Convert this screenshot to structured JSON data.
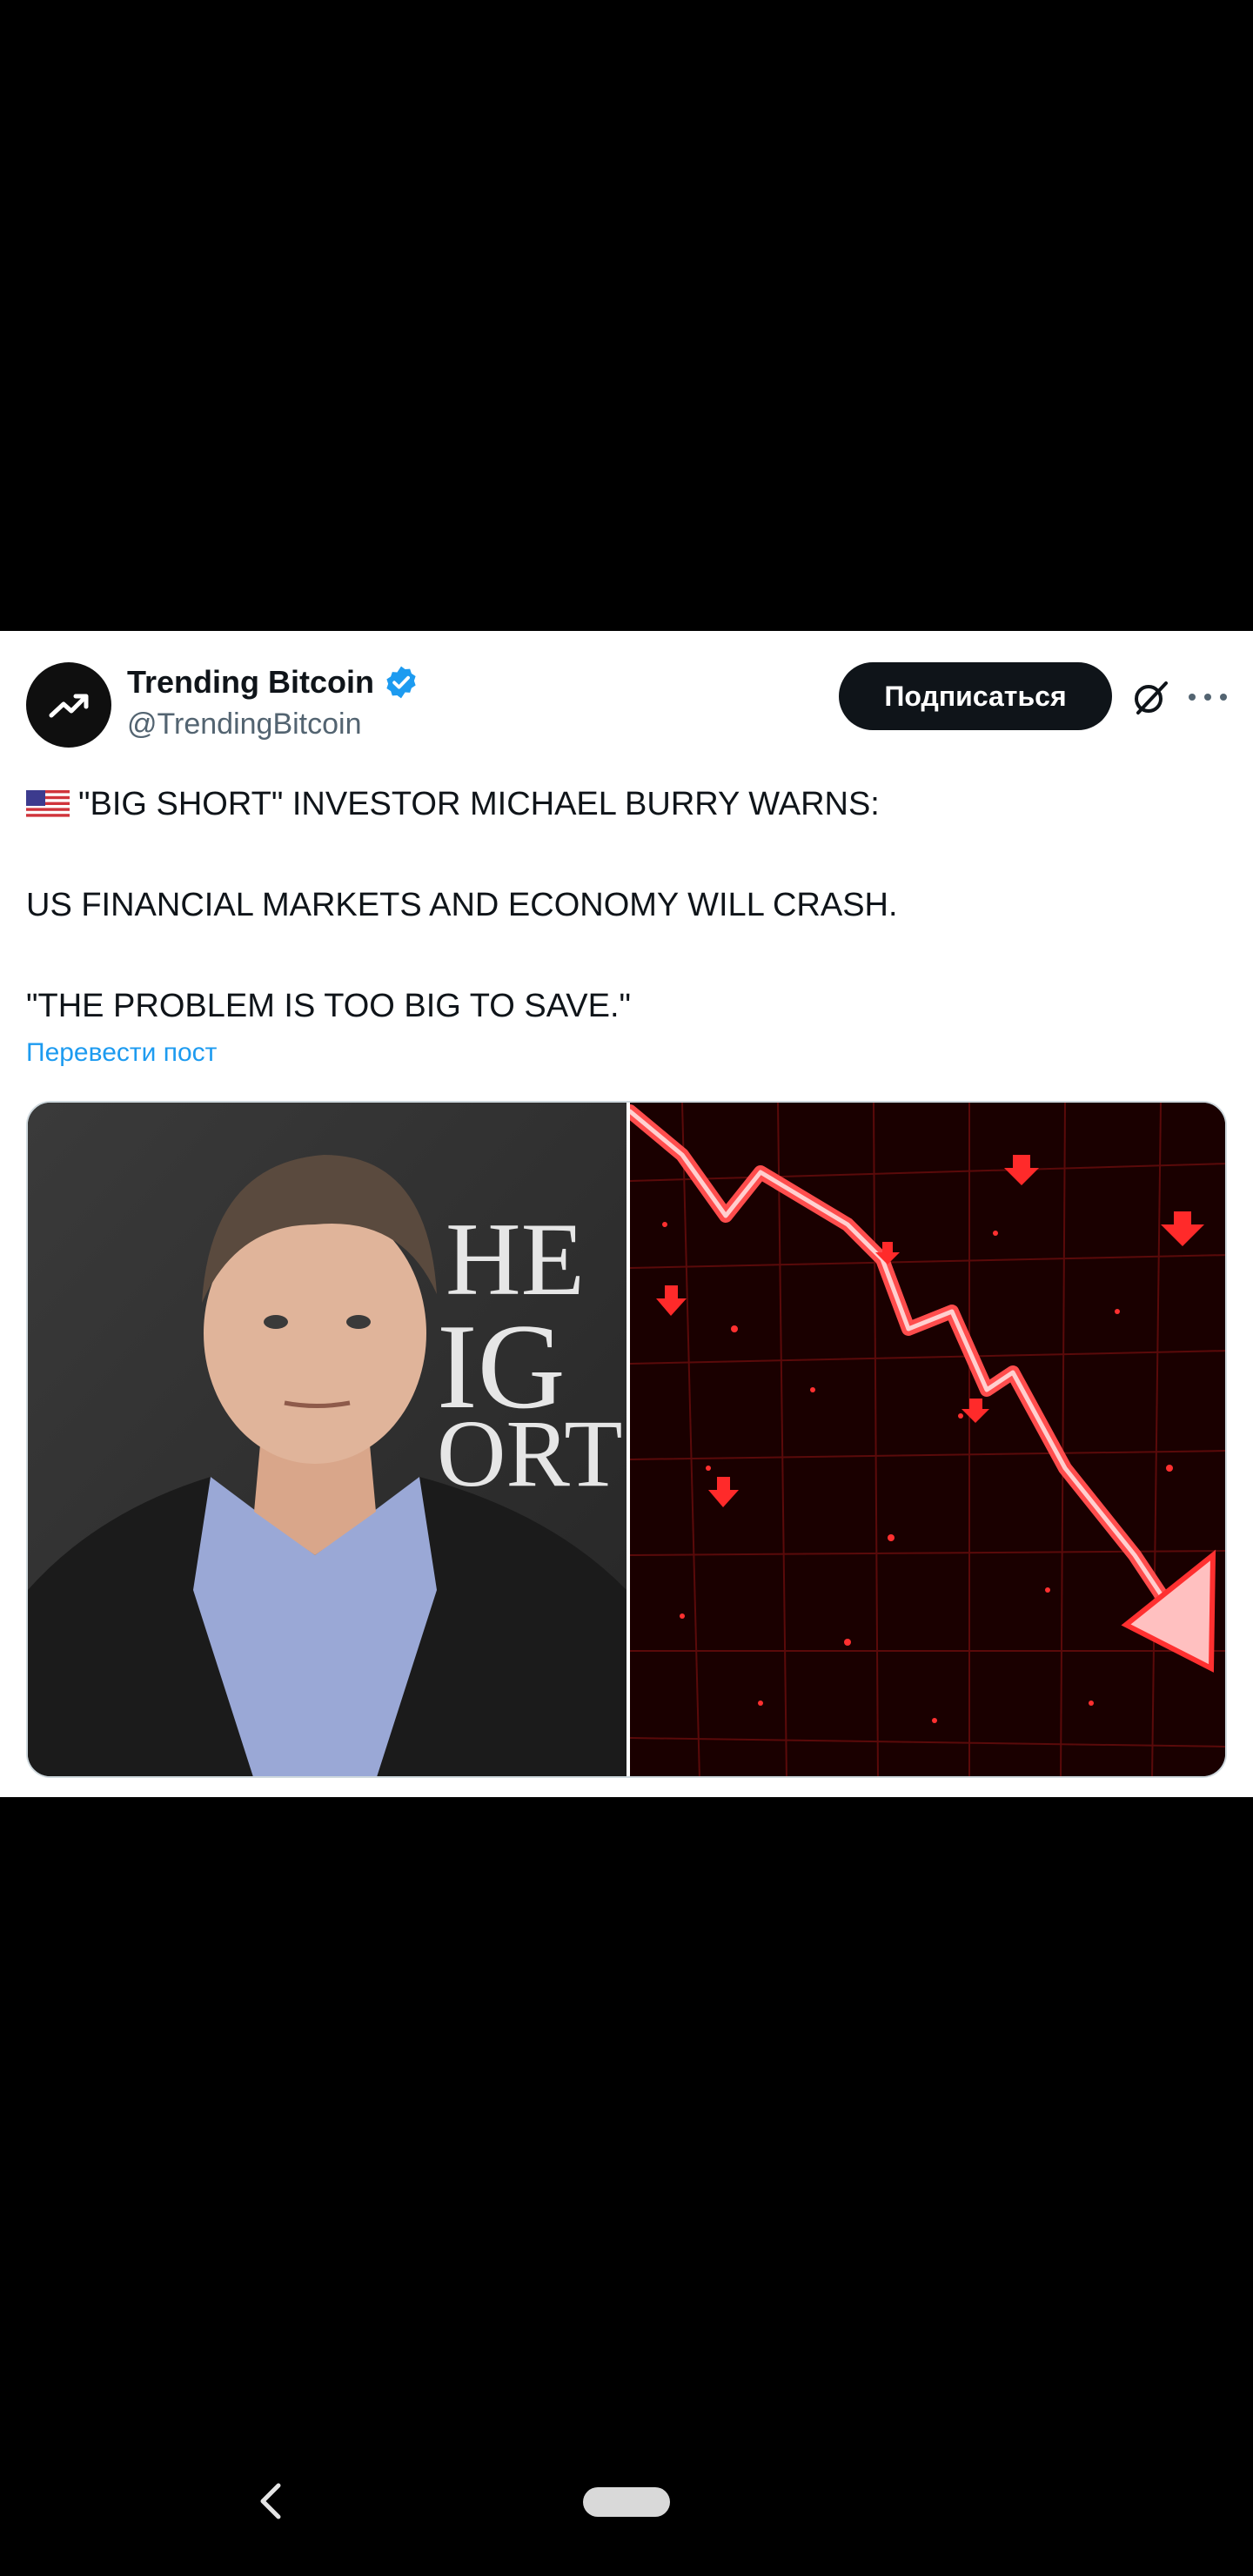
{
  "post": {
    "author_name": "Trending Bitcoin",
    "author_handle": "@TrendingBitcoin",
    "subscribe_label": "Подписаться",
    "text_line_1": "\"BIG SHORT\" INVESTOR MICHAEL BURRY WARNS:",
    "text_line_2": "US FINANCIAL MARKETS AND ECONOMY WILL CRASH.",
    "text_line_3": "\"THE PROBLEM IS TOO BIG TO SAVE.\"",
    "translate_label": "Перевести пост",
    "flag_icon": "us-flag-icon",
    "media": {
      "left_image": "portrait-photo",
      "left_image_text": [
        "HE",
        "IG",
        "ORT"
      ],
      "right_image": "red-falling-chart-image"
    }
  },
  "colors": {
    "card_background": "#ffffff",
    "page_background": "#000000",
    "accent_blue": "#1d9bf0",
    "button_dark": "#0f1419",
    "text_secondary": "#536471",
    "chart_red": "#ff2020"
  },
  "icons": [
    "trending-up-icon",
    "verified-badge-icon",
    "grok-icon",
    "more-icon",
    "back-icon",
    "home-pill-icon"
  ]
}
